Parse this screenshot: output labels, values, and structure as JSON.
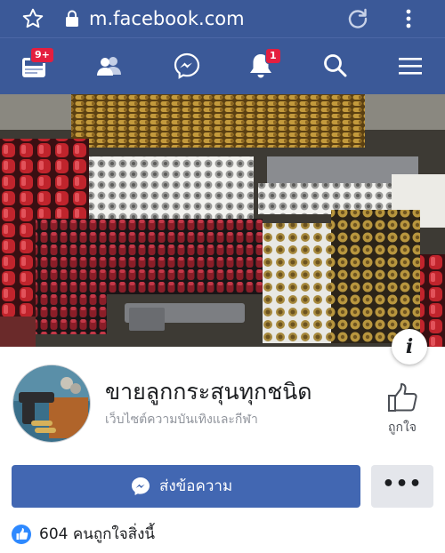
{
  "browser": {
    "url": "m.facebook.com",
    "icons": [
      "star-icon",
      "lock-icon",
      "reload-icon",
      "overflow-menu-icon"
    ]
  },
  "nav": {
    "items": [
      {
        "icon": "news-feed-icon",
        "badge": "9+"
      },
      {
        "icon": "friends-icon",
        "badge": ""
      },
      {
        "icon": "messenger-icon",
        "badge": ""
      },
      {
        "icon": "bell-icon",
        "badge": "1"
      },
      {
        "icon": "search-icon",
        "badge": ""
      },
      {
        "icon": "hamburger-menu-icon",
        "badge": ""
      }
    ],
    "bar_color": "#3b5998",
    "badge_color": "#e41e3f"
  },
  "cover": {
    "info_label": "i"
  },
  "page": {
    "name": "ขายลูกกระสุนทุกชนิด",
    "category": "เว็บไซต์ความบันเทิงและกีฬา",
    "like_label": "ถูกใจ"
  },
  "actions": {
    "send_label": "ส่งข้อความ",
    "more_label": "•••",
    "primary_color": "#4267b2"
  },
  "likes": {
    "text": "604 คนถูกใจสิ่งนี้"
  }
}
